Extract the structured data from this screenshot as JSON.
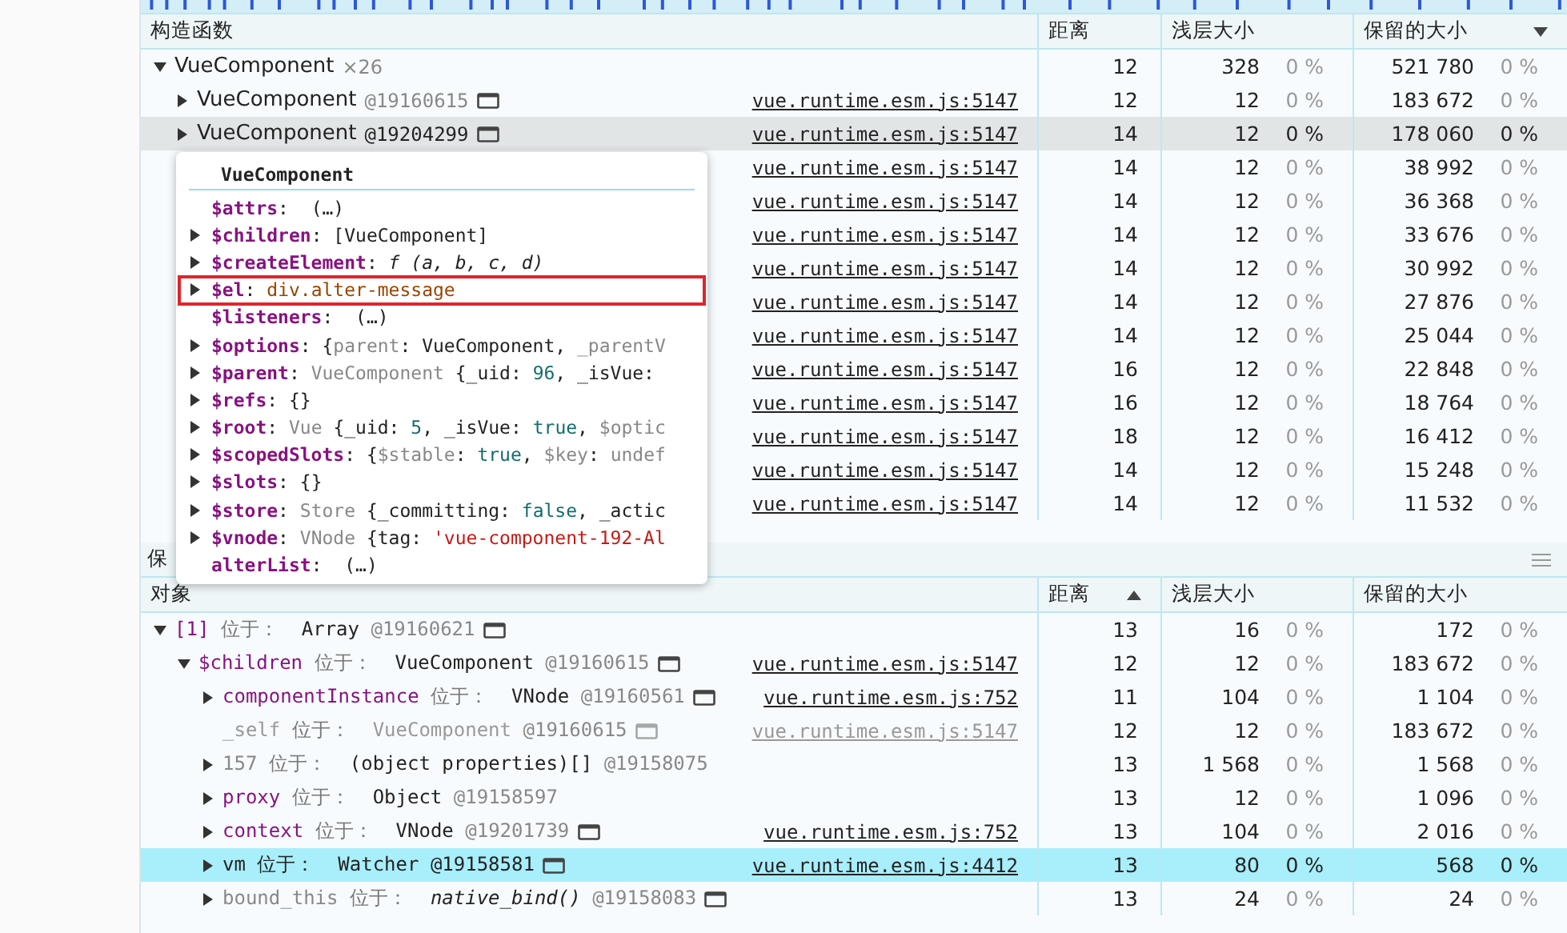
{
  "upper": {
    "columns": [
      {
        "label": "构造函数",
        "sorted": false
      },
      {
        "label": "距离",
        "sorted": false
      },
      {
        "label": "浅层大小",
        "sorted": false
      },
      {
        "label": "保留的大小",
        "sorted": true,
        "descending": true
      }
    ],
    "rows": [
      {
        "name": "VueComponent",
        "count": "×26",
        "expanded": true,
        "selected": false,
        "distance": "12",
        "shallow": "328",
        "shallow_pct": "0 %",
        "retained": "521 780",
        "retained_pct": "0 %",
        "children": [
          {
            "name": "VueComponent",
            "id": "@19160615",
            "reveal": true,
            "expanded": false,
            "selected": false,
            "link": "vue.runtime.esm.js:5147",
            "distance": "12",
            "shallow": "12",
            "shallow_pct": "0 %",
            "retained": "183 672",
            "retained_pct": "0 %"
          },
          {
            "name": "VueComponent",
            "id": "@19204299",
            "reveal": true,
            "expanded": false,
            "selected": true,
            "link": "vue.runtime.esm.js:5147",
            "distance": "14",
            "shallow": "12",
            "shallow_pct": "0 %",
            "retained": "178 060",
            "retained_pct": "0 %"
          },
          {
            "selected": false,
            "link": "vue.runtime.esm.js:5147",
            "distance": "14",
            "shallow": "12",
            "shallow_pct": "0 %",
            "retained": "38 992",
            "retained_pct": "0 %"
          },
          {
            "selected": false,
            "link": "vue.runtime.esm.js:5147",
            "distance": "14",
            "shallow": "12",
            "shallow_pct": "0 %",
            "retained": "36 368",
            "retained_pct": "0 %"
          },
          {
            "selected": false,
            "link": "vue.runtime.esm.js:5147",
            "distance": "14",
            "shallow": "12",
            "shallow_pct": "0 %",
            "retained": "33 676",
            "retained_pct": "0 %"
          },
          {
            "selected": false,
            "link": "vue.runtime.esm.js:5147",
            "distance": "14",
            "shallow": "12",
            "shallow_pct": "0 %",
            "retained": "30 992",
            "retained_pct": "0 %"
          },
          {
            "selected": false,
            "link": "vue.runtime.esm.js:5147",
            "distance": "14",
            "shallow": "12",
            "shallow_pct": "0 %",
            "retained": "27 876",
            "retained_pct": "0 %"
          },
          {
            "selected": false,
            "link": "vue.runtime.esm.js:5147",
            "distance": "14",
            "shallow": "12",
            "shallow_pct": "0 %",
            "retained": "25 044",
            "retained_pct": "0 %"
          },
          {
            "selected": false,
            "link": "vue.runtime.esm.js:5147",
            "distance": "16",
            "shallow": "12",
            "shallow_pct": "0 %",
            "retained": "22 848",
            "retained_pct": "0 %"
          },
          {
            "selected": false,
            "link": "vue.runtime.esm.js:5147",
            "distance": "16",
            "shallow": "12",
            "shallow_pct": "0 %",
            "retained": "18 764",
            "retained_pct": "0 %"
          },
          {
            "selected": false,
            "link": "vue.runtime.esm.js:5147",
            "distance": "18",
            "shallow": "12",
            "shallow_pct": "0 %",
            "retained": "16 412",
            "retained_pct": "0 %"
          },
          {
            "selected": false,
            "link": "vue.runtime.esm.js:5147",
            "distance": "14",
            "shallow": "12",
            "shallow_pct": "0 %",
            "retained": "15 248",
            "retained_pct": "0 %"
          },
          {
            "selected": false,
            "link": "vue.runtime.esm.js:5147",
            "distance": "14",
            "shallow": "12",
            "shallow_pct": "0 %",
            "retained": "11 532",
            "retained_pct": "0 %"
          }
        ]
      }
    ]
  },
  "tooltip": {
    "title": "VueComponent",
    "entries": [
      {
        "expandable": false,
        "highlighted": false,
        "parts": [
          {
            "t": "$attrs",
            "kind": "key"
          },
          {
            "t": ":  ",
            "kind": "plain"
          },
          {
            "t": "(…)",
            "kind": "plain"
          }
        ]
      },
      {
        "expandable": true,
        "highlighted": false,
        "parts": [
          {
            "t": "$children",
            "kind": "key"
          },
          {
            "t": ": ",
            "kind": "plain"
          },
          {
            "t": "[VueComponent]",
            "kind": "plain"
          }
        ]
      },
      {
        "expandable": true,
        "highlighted": false,
        "parts": [
          {
            "t": "$createElement",
            "kind": "key"
          },
          {
            "t": ": ",
            "kind": "plain"
          },
          {
            "t": "f (a, b, c, d)",
            "kind": "italic"
          }
        ]
      },
      {
        "expandable": true,
        "highlighted": true,
        "parts": [
          {
            "t": "$el",
            "kind": "key"
          },
          {
            "t": ": ",
            "kind": "plain"
          },
          {
            "t": "div.alter-message",
            "kind": "element"
          }
        ]
      },
      {
        "expandable": false,
        "highlighted": false,
        "parts": [
          {
            "t": "$listeners",
            "kind": "key"
          },
          {
            "t": ":  ",
            "kind": "plain"
          },
          {
            "t": "(…)",
            "kind": "plain"
          }
        ]
      },
      {
        "expandable": true,
        "highlighted": false,
        "parts": [
          {
            "t": "$options",
            "kind": "key"
          },
          {
            "t": ": {",
            "kind": "plain"
          },
          {
            "t": "parent",
            "kind": "dim"
          },
          {
            "t": ": VueComponent, ",
            "kind": "plain"
          },
          {
            "t": "_parentV",
            "kind": "dim"
          }
        ]
      },
      {
        "expandable": true,
        "highlighted": false,
        "parts": [
          {
            "t": "$parent",
            "kind": "key"
          },
          {
            "t": ": ",
            "kind": "plain"
          },
          {
            "t": "VueComponent ",
            "kind": "dim"
          },
          {
            "t": "{_uid: ",
            "kind": "plain"
          },
          {
            "t": "96",
            "kind": "number"
          },
          {
            "t": ", _isVue:",
            "kind": "plain"
          }
        ]
      },
      {
        "expandable": true,
        "highlighted": false,
        "parts": [
          {
            "t": "$refs",
            "kind": "key"
          },
          {
            "t": ": {}",
            "kind": "plain"
          }
        ]
      },
      {
        "expandable": true,
        "highlighted": false,
        "parts": [
          {
            "t": "$root",
            "kind": "key"
          },
          {
            "t": ": ",
            "kind": "plain"
          },
          {
            "t": "Vue ",
            "kind": "dim"
          },
          {
            "t": "{_uid: ",
            "kind": "plain"
          },
          {
            "t": "5",
            "kind": "number"
          },
          {
            "t": ", _isVue: ",
            "kind": "plain"
          },
          {
            "t": "true",
            "kind": "number"
          },
          {
            "t": ", ",
            "kind": "plain"
          },
          {
            "t": "$optic",
            "kind": "dim"
          }
        ]
      },
      {
        "expandable": true,
        "highlighted": false,
        "parts": [
          {
            "t": "$scopedSlots",
            "kind": "key"
          },
          {
            "t": ": {",
            "kind": "plain"
          },
          {
            "t": "$stable",
            "kind": "dim"
          },
          {
            "t": ": ",
            "kind": "plain"
          },
          {
            "t": "true",
            "kind": "number"
          },
          {
            "t": ", ",
            "kind": "plain"
          },
          {
            "t": "$key",
            "kind": "dim"
          },
          {
            "t": ": ",
            "kind": "plain"
          },
          {
            "t": "undef",
            "kind": "dim"
          }
        ]
      },
      {
        "expandable": true,
        "highlighted": false,
        "parts": [
          {
            "t": "$slots",
            "kind": "key"
          },
          {
            "t": ": {}",
            "kind": "plain"
          }
        ]
      },
      {
        "expandable": true,
        "highlighted": false,
        "parts": [
          {
            "t": "$store",
            "kind": "key"
          },
          {
            "t": ": ",
            "kind": "plain"
          },
          {
            "t": "Store ",
            "kind": "dim"
          },
          {
            "t": "{_committing: ",
            "kind": "plain"
          },
          {
            "t": "false",
            "kind": "number"
          },
          {
            "t": ", _actic",
            "kind": "plain"
          }
        ]
      },
      {
        "expandable": true,
        "highlighted": false,
        "parts": [
          {
            "t": "$vnode",
            "kind": "key"
          },
          {
            "t": ": ",
            "kind": "plain"
          },
          {
            "t": "VNode ",
            "kind": "dim"
          },
          {
            "t": "{tag: ",
            "kind": "plain"
          },
          {
            "t": "'vue-component-192-Al",
            "kind": "string"
          }
        ]
      },
      {
        "expandable": false,
        "highlighted": false,
        "parts": [
          {
            "t": "alterList",
            "kind": "key"
          },
          {
            "t": ":  ",
            "kind": "plain"
          },
          {
            "t": "(…)",
            "kind": "plain"
          }
        ]
      }
    ]
  },
  "retainers_bar": {
    "title": "保"
  },
  "lower": {
    "columns": [
      {
        "label": "对象",
        "sorted": false
      },
      {
        "label": "距离",
        "sorted": true,
        "descending": false
      },
      {
        "label": "浅层大小",
        "sorted": false
      },
      {
        "label": "保留的大小",
        "sorted": false
      }
    ],
    "rows": [
      {
        "expanded": true,
        "selected": false,
        "dimmed": false,
        "parts": [
          {
            "t": "[1]",
            "kind": "key"
          },
          {
            "t": " 位于：  ",
            "kind": "connector"
          },
          {
            "t": "Array",
            "kind": "plain"
          },
          {
            "t": " @19160621",
            "kind": "dim"
          }
        ],
        "reveal": true,
        "distance": "13",
        "shallow": "16",
        "shallow_pct": "0 %",
        "retained": "172",
        "retained_pct": "0 %",
        "children": [
          {
            "expanded": true,
            "selected": false,
            "dimmed": false,
            "parts": [
              {
                "t": "$children",
                "kind": "key"
              },
              {
                "t": " 位于：  ",
                "kind": "connector"
              },
              {
                "t": "VueComponent",
                "kind": "plain"
              },
              {
                "t": " @19160615",
                "kind": "dim"
              }
            ],
            "reveal": true,
            "link": "vue.runtime.esm.js:5147",
            "distance": "12",
            "shallow": "12",
            "shallow_pct": "0 %",
            "retained": "183 672",
            "retained_pct": "0 %",
            "children": [
              {
                "expanded": false,
                "selected": false,
                "dimmed": false,
                "parts": [
                  {
                    "t": "componentInstance",
                    "kind": "key"
                  },
                  {
                    "t": " 位于：  ",
                    "kind": "connector"
                  },
                  {
                    "t": "VNode",
                    "kind": "plain"
                  },
                  {
                    "t": " @19160561",
                    "kind": "dim"
                  }
                ],
                "reveal": true,
                "link": "vue.runtime.esm.js:752",
                "distance": "11",
                "shallow": "104",
                "shallow_pct": "0 %",
                "retained": "1 104",
                "retained_pct": "0 %"
              },
              {
                "selected": false,
                "dimmed": true,
                "parts": [
                  {
                    "t": "_self",
                    "kind": "key"
                  },
                  {
                    "t": " 位于：  ",
                    "kind": "connector"
                  },
                  {
                    "t": "VueComponent",
                    "kind": "plain"
                  },
                  {
                    "t": " @19160615",
                    "kind": "dim"
                  }
                ],
                "reveal": true,
                "link": "vue.runtime.esm.js:5147",
                "distance": "12",
                "shallow": "12",
                "shallow_pct": "0 %",
                "retained": "183 672",
                "retained_pct": "0 %"
              },
              {
                "expanded": false,
                "selected": false,
                "dimmed": false,
                "parts": [
                  {
                    "t": "157",
                    "kind": "dim"
                  },
                  {
                    "t": " 位于：  ",
                    "kind": "connector"
                  },
                  {
                    "t": "(object properties)[]",
                    "kind": "plain"
                  },
                  {
                    "t": " @19158075",
                    "kind": "dim"
                  }
                ],
                "reveal": false,
                "distance": "13",
                "shallow": "1 568",
                "shallow_pct": "0 %",
                "retained": "1 568",
                "retained_pct": "0 %"
              },
              {
                "expanded": false,
                "selected": false,
                "dimmed": false,
                "parts": [
                  {
                    "t": "proxy",
                    "kind": "key"
                  },
                  {
                    "t": " 位于：  ",
                    "kind": "connector"
                  },
                  {
                    "t": "Object",
                    "kind": "plain"
                  },
                  {
                    "t": " @19158597",
                    "kind": "dim"
                  }
                ],
                "reveal": false,
                "distance": "13",
                "shallow": "12",
                "shallow_pct": "0 %",
                "retained": "1 096",
                "retained_pct": "0 %"
              },
              {
                "expanded": false,
                "selected": false,
                "dimmed": false,
                "parts": [
                  {
                    "t": "context",
                    "kind": "key"
                  },
                  {
                    "t": " 位于：  ",
                    "kind": "connector"
                  },
                  {
                    "t": "VNode",
                    "kind": "plain"
                  },
                  {
                    "t": " @19201739",
                    "kind": "dim"
                  }
                ],
                "reveal": true,
                "link": "vue.runtime.esm.js:752",
                "distance": "13",
                "shallow": "104",
                "shallow_pct": "0 %",
                "retained": "2 016",
                "retained_pct": "0 %"
              },
              {
                "expanded": false,
                "selected": true,
                "dimmed": false,
                "parts": [
                  {
                    "t": "vm",
                    "kind": "plain"
                  },
                  {
                    "t": " 位于：  ",
                    "kind": "plain"
                  },
                  {
                    "t": "Watcher @19158581",
                    "kind": "plain"
                  }
                ],
                "reveal": true,
                "link": "vue.runtime.esm.js:4412",
                "distance": "13",
                "shallow": "80",
                "shallow_pct": "0 %",
                "retained": "568",
                "retained_pct": "0 %"
              },
              {
                "expanded": false,
                "selected": false,
                "dimmed": false,
                "parts": [
                  {
                    "t": "bound_this",
                    "kind": "dim"
                  },
                  {
                    "t": " 位于：  ",
                    "kind": "connector"
                  },
                  {
                    "t": "native_bind()",
                    "kind": "italic"
                  },
                  {
                    "t": " @19158083",
                    "kind": "dim"
                  }
                ],
                "reveal": true,
                "distance": "13",
                "shallow": "24",
                "shallow_pct": "0 %",
                "retained": "24",
                "retained_pct": "0 %"
              }
            ]
          }
        ]
      }
    ]
  }
}
